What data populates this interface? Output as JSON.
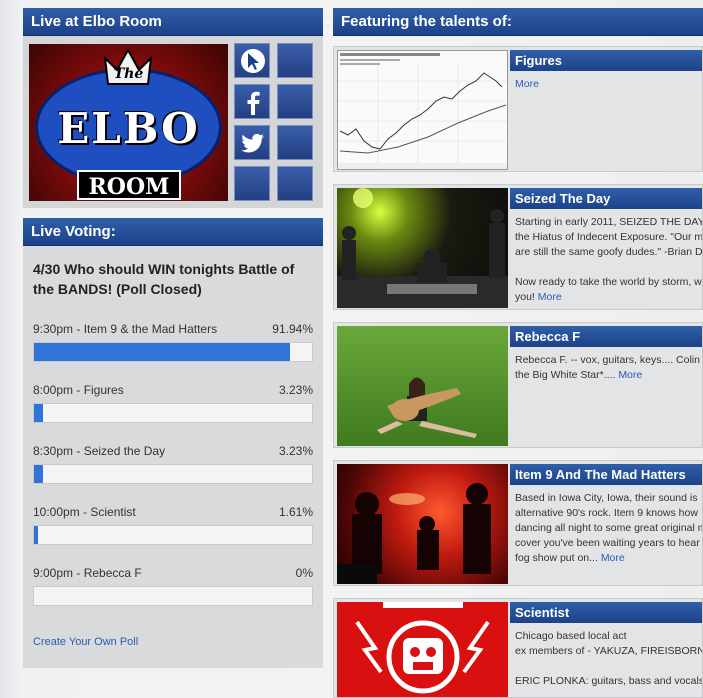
{
  "left_top": {
    "title": "Live at Elbo Room"
  },
  "logo": {
    "the": "The",
    "elbo": "ELBO",
    "room": "ROOM"
  },
  "social": {
    "cursor": "cursor-icon",
    "facebook": "facebook-icon",
    "twitter": "twitter-icon"
  },
  "voting": {
    "title": "Live Voting:",
    "question": "4/30 Who should WIN tonights Battle of the BANDS! (Poll Closed)",
    "options": [
      {
        "label": "9:30pm - Item 9 & the Mad Hatters",
        "pct_text": "91.94%",
        "pct": 91.94
      },
      {
        "label": "8:00pm - Figures",
        "pct_text": "3.23%",
        "pct": 3.23
      },
      {
        "label": "8:30pm - Seized the Day",
        "pct_text": "3.23%",
        "pct": 3.23
      },
      {
        "label": "10:00pm - Scientist",
        "pct_text": "1.61%",
        "pct": 1.61
      },
      {
        "label": "9:00pm - Rebecca F",
        "pct_text": "0%",
        "pct": 0
      }
    ],
    "create_link": "Create Your Own Poll",
    "accent": "#2f74d6"
  },
  "featuring": {
    "title": "Featuring the talents of:",
    "bands": [
      {
        "name": "Figures",
        "lines": [],
        "more": "More"
      },
      {
        "name": "Seized The Day",
        "lines": [
          "Starting in early 2011, SEIZED THE DAY",
          "the Hiatus of Indecent Exposure. \"Our m",
          "are still the same goofy dudes.\" -Brian D",
          "",
          "Now ready to take the world by storm, w",
          "you!"
        ],
        "more": "More"
      },
      {
        "name": "Rebecca F",
        "lines": [
          "Rebecca F. -- vox, guitars, keys.... Colin",
          "the Big White Star*...."
        ],
        "more": "More"
      },
      {
        "name": "Item 9 And The Mad Hatters",
        "lines": [
          "Based in Iowa City, Iowa, their sound is",
          "alternative 90's rock. Item 9 knows how",
          "dancing all night to some great original m",
          "cover you've been waiting years to hear",
          "fog show put on..."
        ],
        "more": "More"
      },
      {
        "name": "Scientist",
        "lines": [
          "Chicago based local act",
          "ex members of - YAKUZA, FIREISBORN",
          "",
          "ERIC PLONKA: guitars, bass and vocals"
        ],
        "more": ""
      }
    ]
  },
  "colors": {
    "header_blue": "#1d4289",
    "link_blue": "#2a5ab8"
  }
}
